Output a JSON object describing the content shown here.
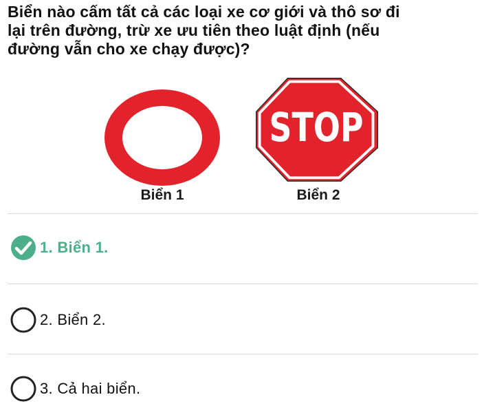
{
  "question": {
    "line1": "Biển nào cấm tất cả các loại xe cơ giới và thô sơ đi",
    "line2": "lại trên đường, trừ xe ưu tiên theo luật định (nếu",
    "line3": "đường vẫn cho xe chạy được)?"
  },
  "signs": [
    {
      "caption": "Biển 1",
      "type": "no-entry-both-directions"
    },
    {
      "caption": "Biển 2",
      "type": "stop",
      "text": "STOP"
    }
  ],
  "options": [
    {
      "label": "1. Biển 1.",
      "state": "correct"
    },
    {
      "label": "2. Biển 2.",
      "state": "unselected"
    },
    {
      "label": "3. Cả hai biển.",
      "state": "unselected"
    }
  ],
  "colors": {
    "correct": "#4caf8a",
    "sign_red": "#e3232b",
    "text": "#111111",
    "divider": "#d9d9d9"
  }
}
